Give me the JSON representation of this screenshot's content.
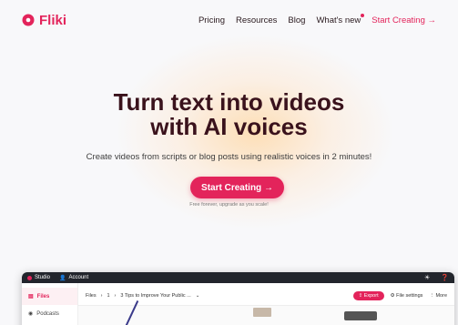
{
  "brand": {
    "name": "Fliki",
    "color": "#e3245b"
  },
  "nav": {
    "links": [
      "Pricing",
      "Resources",
      "Blog",
      "What's new"
    ],
    "cta": "Start Creating →"
  },
  "hero": {
    "title_line1": "Turn text into videos",
    "title_line2": "with AI voices",
    "subtitle": "Create videos from scripts or blog posts using realistic voices in 2 minutes!",
    "cta": "Start Creating →",
    "note": "Free forever, upgrade as you scale!"
  },
  "studio": {
    "tabs": [
      "Studio",
      "Account"
    ],
    "sidebar": [
      "Files",
      "Podcasts"
    ],
    "breadcrumb": [
      "Files",
      "1",
      "3 Tips to Improve Your Public ..."
    ],
    "breadcrumb_sep": "›",
    "breadcrumb_caret": "⌄",
    "export": "Export",
    "file_settings": "File settings",
    "more": "More",
    "theme_icon": "sun-icon",
    "help_icon": "help-icon"
  }
}
